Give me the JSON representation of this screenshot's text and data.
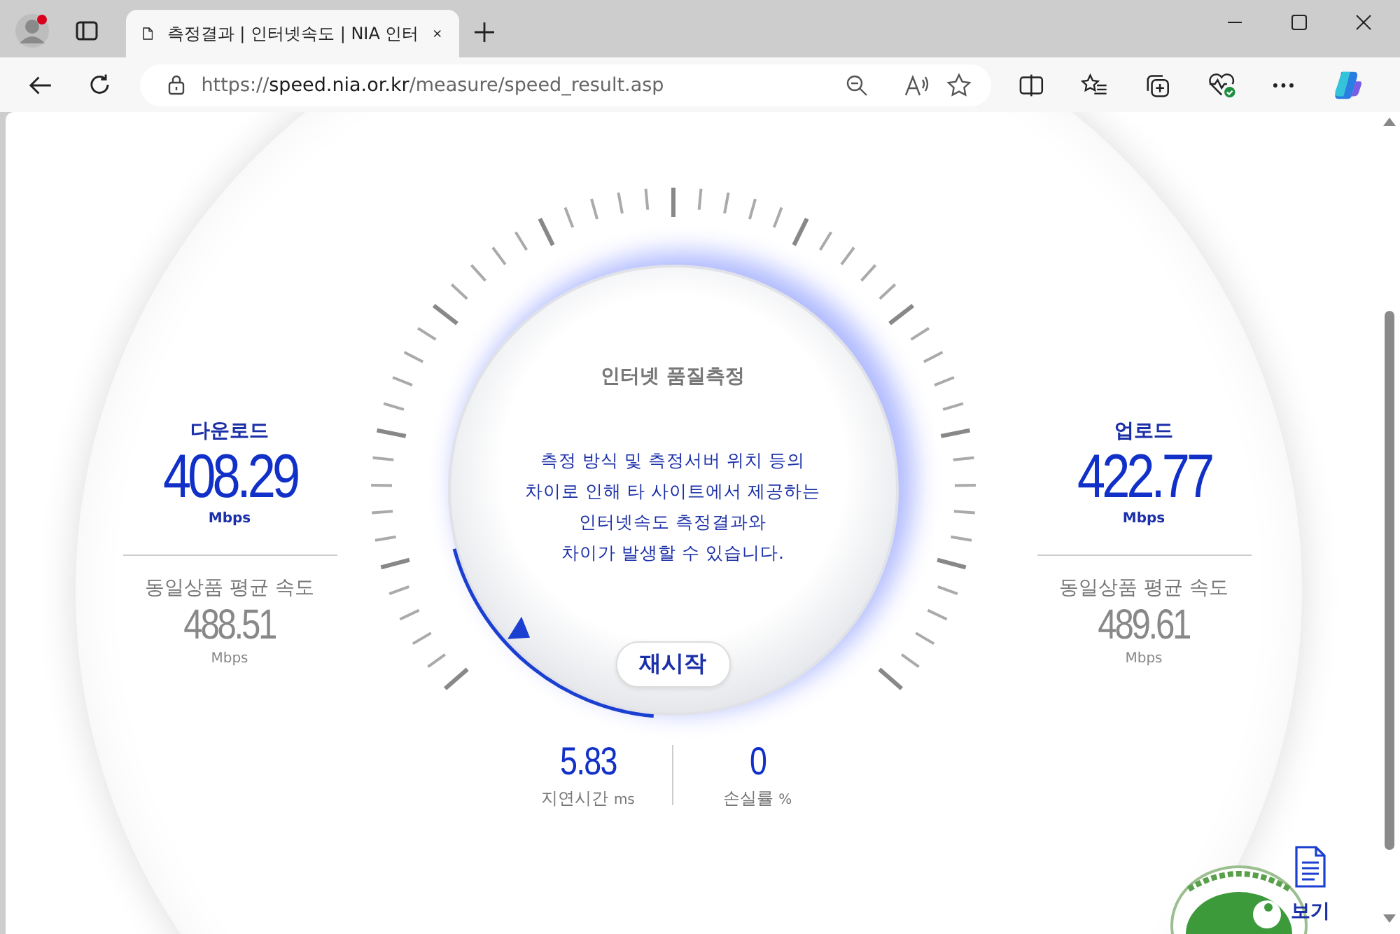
{
  "browser": {
    "tab_title": "측정결과 | 인터넷속도 | NIA 인터",
    "url_scheme": "https://",
    "url_host": "speed.nia.or.kr",
    "url_path": "/measure/speed_result.asp"
  },
  "gauge": {
    "title": "인터넷 품질측정",
    "notice": [
      "측정 방식 및 측정서버 위치 등의",
      "차이로 인해 타 사이트에서 제공하는",
      "인터넷속도 측정결과와",
      "차이가 발생할 수 있습니다."
    ],
    "restart_button": "재시작"
  },
  "download": {
    "label": "다운로드",
    "value": "408.29",
    "unit": "Mbps",
    "avg_label": "동일상품 평균 속도",
    "avg_value": "488.51",
    "avg_unit": "Mbps"
  },
  "upload": {
    "label": "업로드",
    "value": "422.77",
    "unit": "Mbps",
    "avg_label": "동일상품 평균 속도",
    "avg_value": "489.61",
    "avg_unit": "Mbps"
  },
  "latency": {
    "value": "5.83",
    "label": "지연시간",
    "unit": "ms"
  },
  "loss": {
    "value": "0",
    "label": "손실률",
    "unit": "%"
  },
  "footer": {
    "report_link": "보기"
  }
}
